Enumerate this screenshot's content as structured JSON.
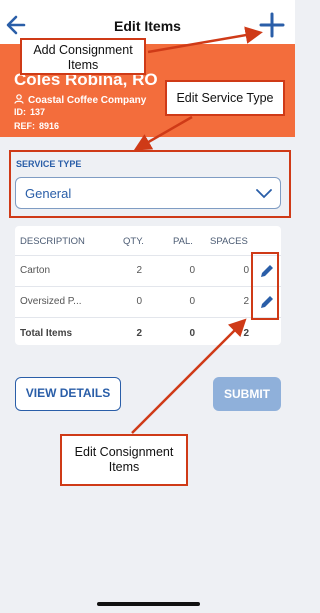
{
  "topbar": {
    "title": "Edit Items",
    "back_icon": "arrow-left-icon",
    "add_icon": "plus-icon"
  },
  "header": {
    "customer": "Coles Robina, RO",
    "company": "Coastal Coffee Company",
    "id_label": "ID:",
    "id_value": "137",
    "ref_label": "REF:",
    "ref_value": "8916"
  },
  "service": {
    "label": "SERVICE TYPE",
    "value": "General"
  },
  "table": {
    "headers": [
      "DESCRIPTION",
      "QTY.",
      "PAL.",
      "SPACES"
    ],
    "rows": [
      {
        "description": "Carton",
        "qty": "2",
        "pal": "0",
        "spaces": "0"
      },
      {
        "description": "Oversized P...",
        "qty": "0",
        "pal": "0",
        "spaces": "2"
      }
    ],
    "total": {
      "label": "Total Items",
      "qty": "2",
      "pal": "0",
      "spaces": "2"
    }
  },
  "buttons": {
    "details": "VIEW DETAILS",
    "submit": "SUBMIT"
  },
  "annotations": {
    "add": "Add Consignment Items",
    "service": "Edit Service Type",
    "edit": "Edit Consignment Items"
  },
  "colors": {
    "accent": "#2a5ea8",
    "header": "#f36d3c",
    "annotation": "#cf3a17",
    "submit_disabled": "#8fb0da"
  }
}
